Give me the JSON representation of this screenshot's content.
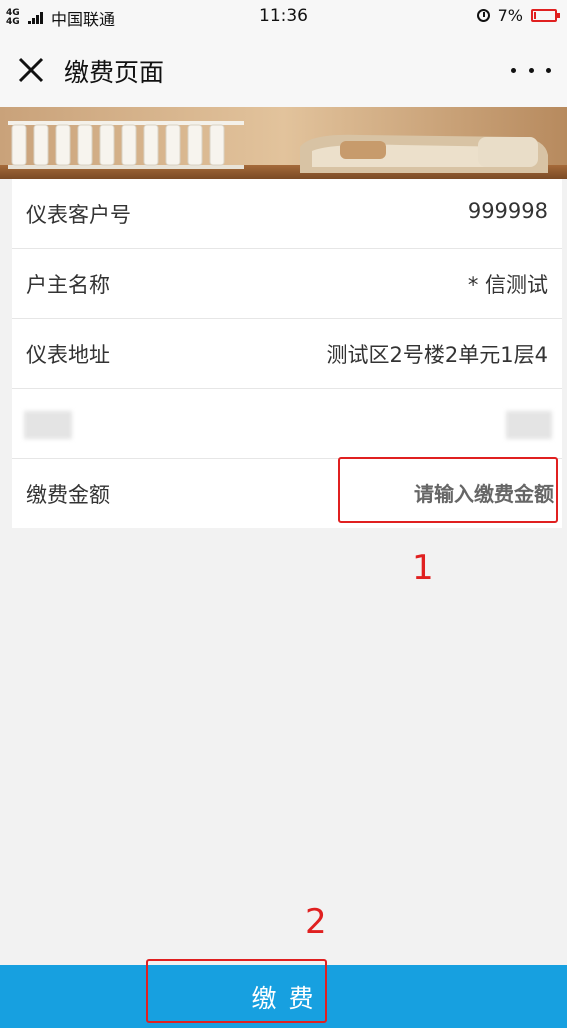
{
  "status_bar": {
    "network": "4G 4G",
    "carrier": "中国联通",
    "time": "11:36",
    "battery_percent": "7%",
    "battery_color": "#e02020"
  },
  "header": {
    "title": "缴费页面",
    "close_icon": "close-icon",
    "more_icon": "more-icon"
  },
  "form": {
    "rows": [
      {
        "label": "仪表客户号",
        "value": "999998"
      },
      {
        "label": "户主名称",
        "value": "* 信测试"
      },
      {
        "label": "仪表地址",
        "value": "测试区2号楼2单元1层4"
      },
      {
        "label": "缴费金额",
        "placeholder": "请输入缴费金额"
      }
    ]
  },
  "annotations": {
    "first": "1",
    "second": "2",
    "color": "#e02020"
  },
  "footer": {
    "pay_label": "缴费",
    "accent": "#17a0e0"
  }
}
